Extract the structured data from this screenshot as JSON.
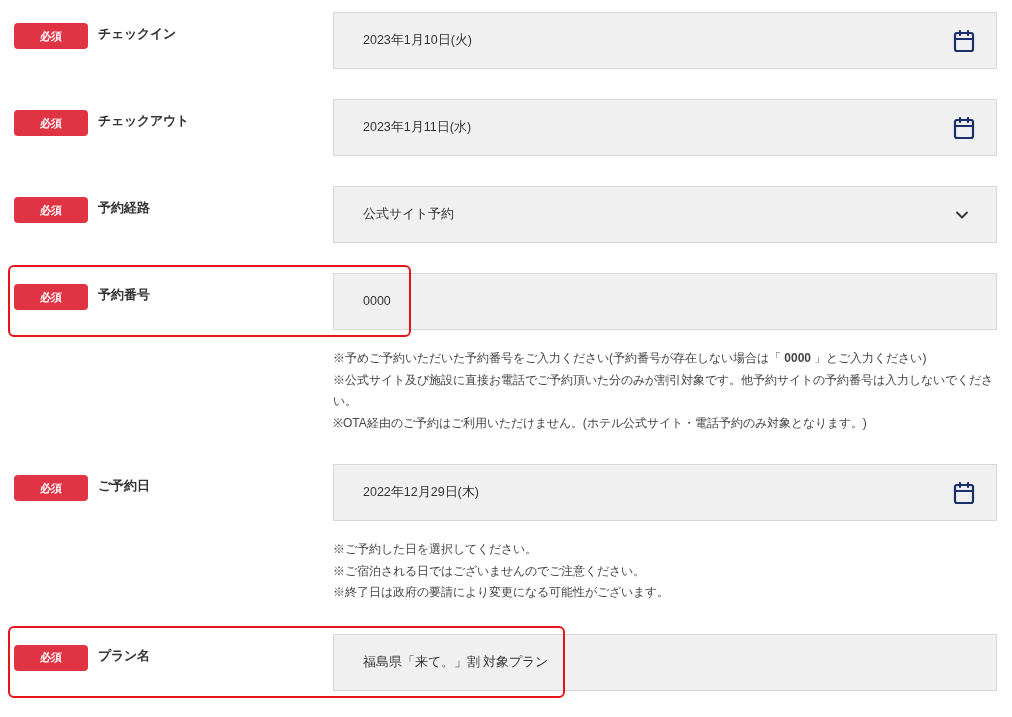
{
  "fields": [
    {
      "badge": "必須",
      "label": "チェックイン",
      "kind": "date",
      "value": "2023年1月10日(火)",
      "highlighted": false
    },
    {
      "badge": "必須",
      "label": "チェックアウト",
      "kind": "date",
      "value": "2023年1月11日(水)",
      "highlighted": false
    },
    {
      "badge": "必須",
      "label": "予約経路",
      "kind": "select",
      "value": "公式サイト予約",
      "highlighted": false
    },
    {
      "badge": "必須",
      "label": "予約番号",
      "kind": "text",
      "value": "0000",
      "highlighted": true,
      "notes": [
        "※予めご予約いただいた予約番号をご入力ください(予約番号が存在しない場合は「 **0000** 」とご入力ください)",
        "※公式サイト及び施設に直接お電話でご予約頂いた分のみが割引対象です。他予約サイトの予約番号は入力しないでください。",
        "※OTA経由のご予約はご利用いただけません。(ホテル公式サイト・電話予約のみ対象となります。)"
      ]
    },
    {
      "badge": "必須",
      "label": "ご予約日",
      "kind": "date",
      "value": "2022年12月29日(木)",
      "highlighted": false,
      "notes": [
        "※ご予約した日を選択してください。",
        "※ご宿泊される日ではございませんのでご注意ください。",
        "※終了日は政府の要請により変更になる可能性がございます。"
      ]
    },
    {
      "badge": "必須",
      "label": "プラン名",
      "kind": "text",
      "value": "福島県「来て。」割 対象プラン",
      "highlighted": true
    }
  ]
}
